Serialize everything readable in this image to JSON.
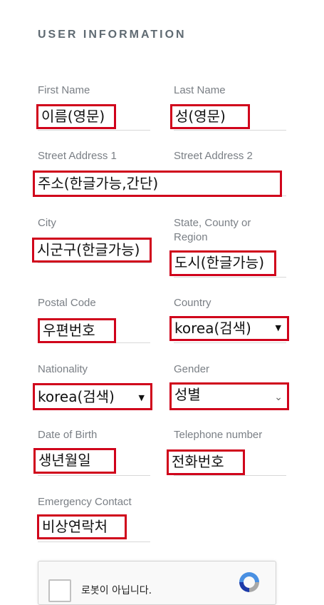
{
  "section_title": "USER INFORMATION",
  "fields": {
    "first_name": {
      "label": "First Name",
      "value": "이름(영문)"
    },
    "last_name": {
      "label": "Last Name",
      "value": "성(영문)"
    },
    "street1": {
      "label": "Street Address 1",
      "value": "주소(한글가능,간단)"
    },
    "street2": {
      "label": "Street Address 2"
    },
    "city": {
      "label": "City",
      "value": "시군구(한글가능)"
    },
    "state": {
      "label_line1": "State, County or",
      "label_line2": "Region",
      "value": "도시(한글가능)"
    },
    "postal": {
      "label": "Postal Code",
      "value": "우편번호"
    },
    "country": {
      "label": "Country",
      "value": "korea(검색)"
    },
    "nationality": {
      "label": "Nationality",
      "value": "korea(검색)"
    },
    "gender": {
      "label": "Gender",
      "value": "성별"
    },
    "dob": {
      "label": "Date of Birth",
      "value": "생년월일"
    },
    "phone": {
      "label": "Telephone number",
      "value": "전화번호"
    },
    "emergency": {
      "label": "Emergency Contact",
      "value": "비상연락처"
    }
  },
  "captcha": {
    "text": "로봇이 아닙니다."
  },
  "icons": {
    "select_arrow": "triangle-down-icon",
    "chevron": "chevron-down-icon",
    "recaptcha": "recaptcha-logo-icon"
  },
  "colors": {
    "annotation": "#d0021b",
    "label": "#7a7f85",
    "title": "#5f6a72"
  }
}
